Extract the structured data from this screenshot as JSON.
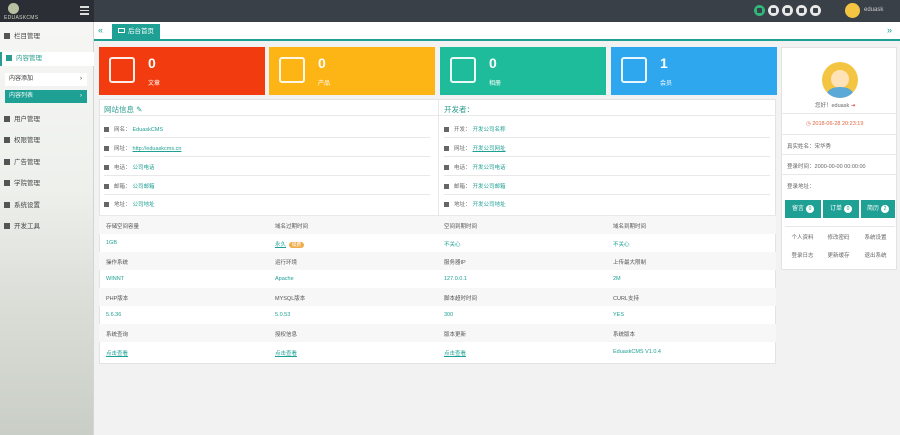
{
  "app": {
    "logo_text": "EDUASKCMS",
    "user_name": "eduask"
  },
  "sidebar": {
    "items": [
      {
        "label": "栏目管理"
      },
      {
        "label": "内容管理"
      },
      {
        "label": "用户管理"
      },
      {
        "label": "权限管理"
      },
      {
        "label": "广告管理"
      },
      {
        "label": "学院管理"
      },
      {
        "label": "系统设置"
      },
      {
        "label": "开发工具"
      }
    ],
    "sub_items": [
      {
        "label": "内容添加"
      },
      {
        "label": "内容列表"
      }
    ]
  },
  "tabs": {
    "home_label": "后台首页"
  },
  "stats": [
    {
      "value": "0",
      "label": "文章",
      "color": "#f23c10"
    },
    {
      "value": "0",
      "label": "产品",
      "color": "#fdb415"
    },
    {
      "value": "0",
      "label": "相册",
      "color": "#1ebc9b"
    },
    {
      "value": "1",
      "label": "会员",
      "color": "#2ea7ef"
    }
  ],
  "site_info": {
    "title": "网站信息",
    "rows": [
      {
        "label": "网名：",
        "value": "EduaskCMS"
      },
      {
        "label": "网址：",
        "value": "http://eduaskcms.cn"
      },
      {
        "label": "电话：",
        "value": "公司电话"
      },
      {
        "label": "邮箱：",
        "value": "公司邮箱"
      },
      {
        "label": "地址：",
        "value": "公司地址"
      }
    ]
  },
  "dev_info": {
    "title": "开发者：",
    "rows": [
      {
        "label": "开发：",
        "value": "开发公司名称"
      },
      {
        "label": "网址：",
        "value": "开发公司网址"
      },
      {
        "label": "电话：",
        "value": "开发公司电话"
      },
      {
        "label": "邮箱：",
        "value": "开发公司邮箱"
      },
      {
        "label": "地址：",
        "value": "开发公司地址"
      }
    ]
  },
  "system_grid": [
    {
      "label": "存储空间容量",
      "value": "1GB"
    },
    {
      "label": "域名过期时间",
      "value": "永久",
      "badge": "续费"
    },
    {
      "label": "空间到期时间",
      "value": "不关心"
    },
    {
      "label": "域名到期时间",
      "value": "不关心"
    },
    {
      "label": "操作系统",
      "value": "WINNT"
    },
    {
      "label": "运行环境",
      "value": "Apache"
    },
    {
      "label": "服务器IP",
      "value": "127.0.0.1"
    },
    {
      "label": "上传最大限制",
      "value": "2M"
    },
    {
      "label": "PHP版本",
      "value": "5.6.36"
    },
    {
      "label": "MYSQL版本",
      "value": "5.0.53"
    },
    {
      "label": "脚本超时时间",
      "value": "300"
    },
    {
      "label": "CURL支持",
      "value": "YES"
    },
    {
      "label": "系统查询",
      "value": "点击查看"
    },
    {
      "label": "授权信息",
      "value": "点击查看"
    },
    {
      "label": "版本更新",
      "value": "点击查看"
    },
    {
      "label": "系统版本",
      "value": "EduaskCMS V1.0.4"
    }
  ],
  "right_panel": {
    "welcome": "您好！eduask",
    "time": "2018-06-28 20:23:19",
    "real_name_label": "真实姓名：",
    "real_name": "宋华秀",
    "last_login_label": "登录时间：",
    "last_login": "2000-00-00 00:00:00",
    "login_ip_label": "登录地址：",
    "buttons": [
      {
        "label": "留言",
        "count": "0"
      },
      {
        "label": "订单",
        "count": "0"
      },
      {
        "label": "简历",
        "count": "2"
      }
    ],
    "links": [
      "个人资料",
      "修改密码",
      "系统设置",
      "登录日志",
      "更新缓存",
      "退出系统"
    ]
  }
}
